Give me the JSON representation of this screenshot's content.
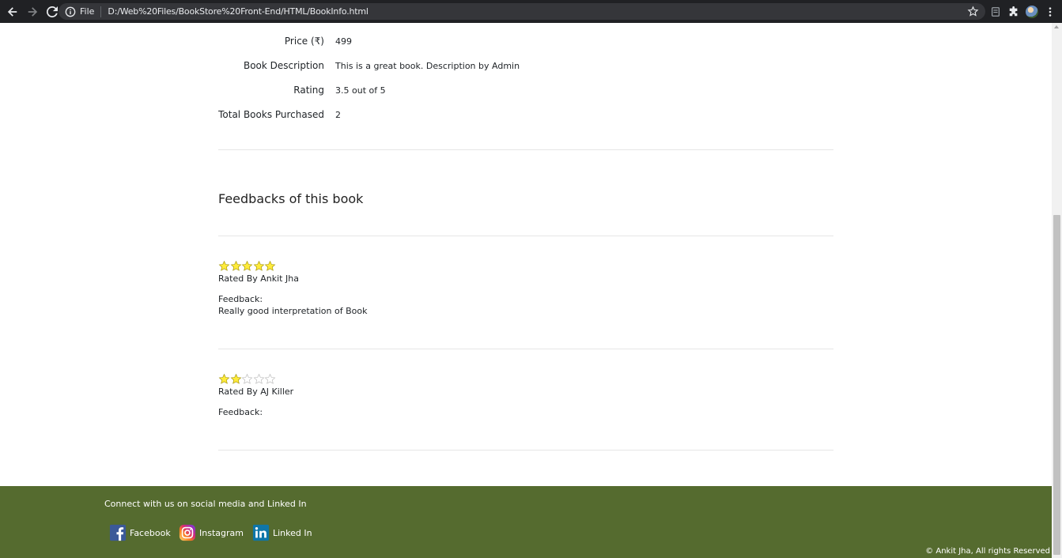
{
  "browser": {
    "file_label": "File",
    "url": "D:/Web%20Files/BookStore%20Front-End/HTML/BookInfo.html"
  },
  "book_info": [
    {
      "label": "Price (₹)",
      "value": "499"
    },
    {
      "label": "Book Description",
      "value": "This is a great book. Description by Admin"
    },
    {
      "label": "Rating",
      "value": "3.5 out of 5"
    },
    {
      "label": "Total Books Purchased",
      "value": "2"
    }
  ],
  "feedback_section": {
    "title": "Feedbacks of this book",
    "feedbacks": [
      {
        "stars": 5,
        "max_stars": 5,
        "rated_by": "Rated By Ankit Jha",
        "feedback_label": "Feedback:",
        "feedback_text": "Really good interpretation of Book"
      },
      {
        "stars": 2,
        "max_stars": 5,
        "rated_by": "Rated By AJ Killer",
        "feedback_label": "Feedback:",
        "feedback_text": ""
      }
    ]
  },
  "footer": {
    "connect_text": "Connect with us on social media and Linked In",
    "social_links": [
      {
        "label": "Facebook",
        "icon": "facebook-icon"
      },
      {
        "label": "Instagram",
        "icon": "instagram-icon"
      },
      {
        "label": "Linked In",
        "icon": "linkedin-icon"
      }
    ],
    "copyright": "© Ankit Jha, All rights Reserved"
  },
  "colors": {
    "footer_bg": "#556b2f",
    "star_filled": "#ffeb3b",
    "star_outline": "#b5b5b5"
  }
}
